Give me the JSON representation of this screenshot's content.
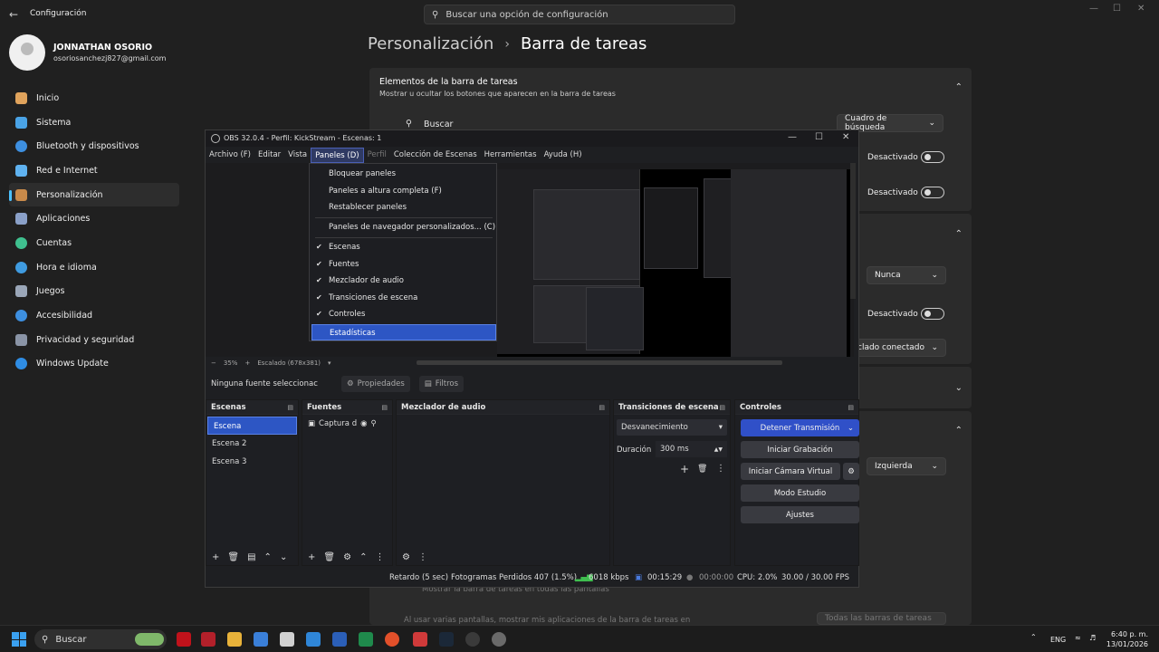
{
  "settings": {
    "window_title": "Configuración",
    "search_placeholder": "Buscar una opción de configuración",
    "user_name": "JONNATHAN OSORIO",
    "user_email": "osoriosanchezj827@gmail.com",
    "nav": [
      {
        "label": "Inicio",
        "color": "#e0a35c"
      },
      {
        "label": "Sistema",
        "color": "#4aa3e6"
      },
      {
        "label": "Bluetooth y dispositivos",
        "color": "#3d8fe0"
      },
      {
        "label": "Red e Internet",
        "color": "#5fb2f0"
      },
      {
        "label": "Personalización",
        "color": "#c98a4a"
      },
      {
        "label": "Aplicaciones",
        "color": "#8aa0c8"
      },
      {
        "label": "Cuentas",
        "color": "#3fc08f"
      },
      {
        "label": "Hora e idioma",
        "color": "#3f9be0"
      },
      {
        "label": "Juegos",
        "color": "#9aa6b8"
      },
      {
        "label": "Accesibilidad",
        "color": "#3d8fe0"
      },
      {
        "label": "Privacidad y seguridad",
        "color": "#8a94a6"
      },
      {
        "label": "Windows Update",
        "color": "#2f8de4"
      }
    ],
    "crumb_parent": "Personalización",
    "crumb_current": "Barra de tareas",
    "card1_title": "Elementos de la barra de tareas",
    "card1_sub": "Mostrar u ocultar los botones que aparecen en la barra de tareas",
    "search_row_label": "Buscar",
    "search_dropdown": "Cuadro de búsqueda",
    "toggle_off": "Desactivado",
    "dropdown_never": "Nunca",
    "dropdown_connected": "clado conectado",
    "dropdown_left": "Izquierda",
    "bottom_row1": "Mostrar la barra de tareas en todas las pantallas",
    "bottom_row2": "Al usar varias pantallas, mostrar mis aplicaciones de la barra de tareas en",
    "bottom_dropdown": "Todas las barras de tareas"
  },
  "obs": {
    "title": "OBS 32.0.4 - Perfil: KickStream - Escenas: 1",
    "menu": [
      "Archivo (F)",
      "Editar",
      "Vista",
      "Paneles (D)",
      "Perfil",
      "Colección de Escenas",
      "Herramientas",
      "Ayuda (H)"
    ],
    "panels_menu": {
      "lock": "Bloquear paneles",
      "full_height": "Paneles a altura completa (F)",
      "reset": "Restablecer paneles",
      "custom": "Paneles de navegador personalizados... (C)",
      "scenes": "Escenas",
      "sources": "Fuentes",
      "mixer": "Mezclador de audio",
      "transitions": "Transiciones de escena",
      "controls": "Controles",
      "stats": "Estadísticas"
    },
    "zoom": "35%",
    "scaling": "Escalado (678x381)",
    "no_source": "Ninguna fuente seleccionac",
    "properties": "Propiedades",
    "filters": "Filtros",
    "docks": {
      "scenes": "Escenas",
      "sources": "Fuentes",
      "mixer": "Mezclador de audio",
      "transitions": "Transiciones de escena",
      "controls": "Controles"
    },
    "scene_list": [
      "Escena",
      "Escena 2",
      "Escena 3"
    ],
    "source_item": "Captura d",
    "transition": "Desvanecimiento",
    "duration_label": "Duración",
    "duration_value": "300 ms",
    "controls": {
      "stop_stream": "Detener Transmisión",
      "start_rec": "Iniciar Grabación",
      "virtual_cam": "Iniciar Cámara Virtual",
      "studio": "Modo Estudio",
      "settings": "Ajustes"
    },
    "status": {
      "delay": "Retardo (5 sec)",
      "dropped": "Fotogramas Perdidos 407 (1.5%)",
      "bitrate": "6018 kbps",
      "live_time": "00:15:29",
      "rec_time": "00:00:00",
      "cpu": "CPU: 2.0%",
      "fps": "30.00 / 30.00 FPS"
    }
  },
  "taskbar": {
    "search": "Buscar",
    "lang": "ENG",
    "time": "6:40 p. m.",
    "date": "13/01/2026"
  }
}
